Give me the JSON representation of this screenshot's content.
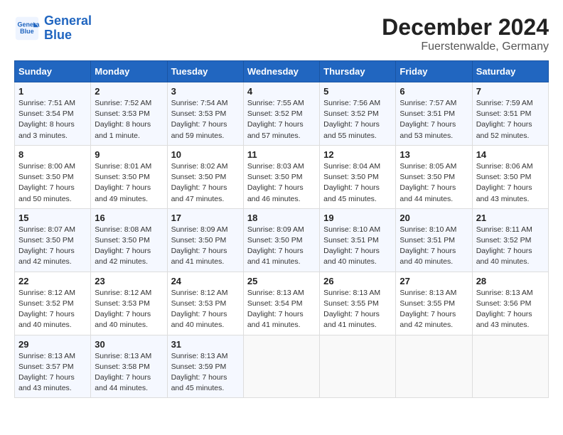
{
  "header": {
    "logo_line1": "General",
    "logo_line2": "Blue",
    "month": "December 2024",
    "location": "Fuerstenwalde, Germany"
  },
  "weekdays": [
    "Sunday",
    "Monday",
    "Tuesday",
    "Wednesday",
    "Thursday",
    "Friday",
    "Saturday"
  ],
  "weeks": [
    [
      {
        "day": "1",
        "info": "Sunrise: 7:51 AM\nSunset: 3:54 PM\nDaylight: 8 hours\nand 3 minutes."
      },
      {
        "day": "2",
        "info": "Sunrise: 7:52 AM\nSunset: 3:53 PM\nDaylight: 8 hours\nand 1 minute."
      },
      {
        "day": "3",
        "info": "Sunrise: 7:54 AM\nSunset: 3:53 PM\nDaylight: 7 hours\nand 59 minutes."
      },
      {
        "day": "4",
        "info": "Sunrise: 7:55 AM\nSunset: 3:52 PM\nDaylight: 7 hours\nand 57 minutes."
      },
      {
        "day": "5",
        "info": "Sunrise: 7:56 AM\nSunset: 3:52 PM\nDaylight: 7 hours\nand 55 minutes."
      },
      {
        "day": "6",
        "info": "Sunrise: 7:57 AM\nSunset: 3:51 PM\nDaylight: 7 hours\nand 53 minutes."
      },
      {
        "day": "7",
        "info": "Sunrise: 7:59 AM\nSunset: 3:51 PM\nDaylight: 7 hours\nand 52 minutes."
      }
    ],
    [
      {
        "day": "8",
        "info": "Sunrise: 8:00 AM\nSunset: 3:50 PM\nDaylight: 7 hours\nand 50 minutes."
      },
      {
        "day": "9",
        "info": "Sunrise: 8:01 AM\nSunset: 3:50 PM\nDaylight: 7 hours\nand 49 minutes."
      },
      {
        "day": "10",
        "info": "Sunrise: 8:02 AM\nSunset: 3:50 PM\nDaylight: 7 hours\nand 47 minutes."
      },
      {
        "day": "11",
        "info": "Sunrise: 8:03 AM\nSunset: 3:50 PM\nDaylight: 7 hours\nand 46 minutes."
      },
      {
        "day": "12",
        "info": "Sunrise: 8:04 AM\nSunset: 3:50 PM\nDaylight: 7 hours\nand 45 minutes."
      },
      {
        "day": "13",
        "info": "Sunrise: 8:05 AM\nSunset: 3:50 PM\nDaylight: 7 hours\nand 44 minutes."
      },
      {
        "day": "14",
        "info": "Sunrise: 8:06 AM\nSunset: 3:50 PM\nDaylight: 7 hours\nand 43 minutes."
      }
    ],
    [
      {
        "day": "15",
        "info": "Sunrise: 8:07 AM\nSunset: 3:50 PM\nDaylight: 7 hours\nand 42 minutes."
      },
      {
        "day": "16",
        "info": "Sunrise: 8:08 AM\nSunset: 3:50 PM\nDaylight: 7 hours\nand 42 minutes."
      },
      {
        "day": "17",
        "info": "Sunrise: 8:09 AM\nSunset: 3:50 PM\nDaylight: 7 hours\nand 41 minutes."
      },
      {
        "day": "18",
        "info": "Sunrise: 8:09 AM\nSunset: 3:50 PM\nDaylight: 7 hours\nand 41 minutes."
      },
      {
        "day": "19",
        "info": "Sunrise: 8:10 AM\nSunset: 3:51 PM\nDaylight: 7 hours\nand 40 minutes."
      },
      {
        "day": "20",
        "info": "Sunrise: 8:10 AM\nSunset: 3:51 PM\nDaylight: 7 hours\nand 40 minutes."
      },
      {
        "day": "21",
        "info": "Sunrise: 8:11 AM\nSunset: 3:52 PM\nDaylight: 7 hours\nand 40 minutes."
      }
    ],
    [
      {
        "day": "22",
        "info": "Sunrise: 8:12 AM\nSunset: 3:52 PM\nDaylight: 7 hours\nand 40 minutes."
      },
      {
        "day": "23",
        "info": "Sunrise: 8:12 AM\nSunset: 3:53 PM\nDaylight: 7 hours\nand 40 minutes."
      },
      {
        "day": "24",
        "info": "Sunrise: 8:12 AM\nSunset: 3:53 PM\nDaylight: 7 hours\nand 40 minutes."
      },
      {
        "day": "25",
        "info": "Sunrise: 8:13 AM\nSunset: 3:54 PM\nDaylight: 7 hours\nand 41 minutes."
      },
      {
        "day": "26",
        "info": "Sunrise: 8:13 AM\nSunset: 3:55 PM\nDaylight: 7 hours\nand 41 minutes."
      },
      {
        "day": "27",
        "info": "Sunrise: 8:13 AM\nSunset: 3:55 PM\nDaylight: 7 hours\nand 42 minutes."
      },
      {
        "day": "28",
        "info": "Sunrise: 8:13 AM\nSunset: 3:56 PM\nDaylight: 7 hours\nand 43 minutes."
      }
    ],
    [
      {
        "day": "29",
        "info": "Sunrise: 8:13 AM\nSunset: 3:57 PM\nDaylight: 7 hours\nand 43 minutes."
      },
      {
        "day": "30",
        "info": "Sunrise: 8:13 AM\nSunset: 3:58 PM\nDaylight: 7 hours\nand 44 minutes."
      },
      {
        "day": "31",
        "info": "Sunrise: 8:13 AM\nSunset: 3:59 PM\nDaylight: 7 hours\nand 45 minutes."
      },
      {
        "day": "",
        "info": ""
      },
      {
        "day": "",
        "info": ""
      },
      {
        "day": "",
        "info": ""
      },
      {
        "day": "",
        "info": ""
      }
    ]
  ]
}
